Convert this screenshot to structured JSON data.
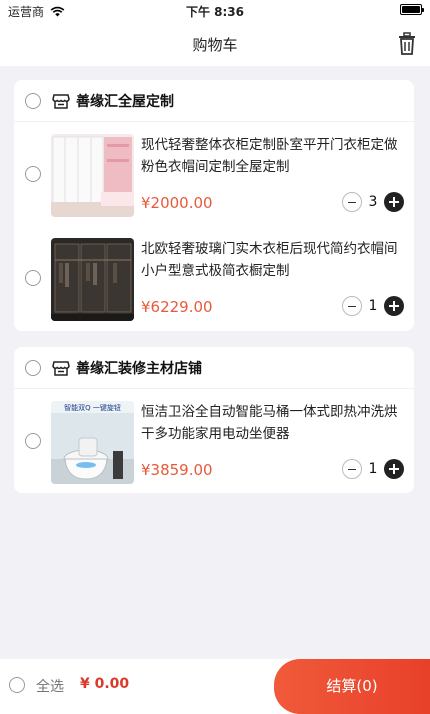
{
  "status_bar": {
    "carrier": "运营商",
    "time": "下午 8:36"
  },
  "header": {
    "title": "购物车"
  },
  "stores": [
    {
      "name": "善缘汇全屋定制",
      "items": [
        {
          "title": "现代轻奢整体衣柜定制卧室平开门衣柜定做粉色衣帽间定制全屋定制",
          "price": "¥2000.00",
          "quantity": "3"
        },
        {
          "title": "北欧轻奢玻璃门实木衣柜后现代简约衣帽间小户型意式极简衣橱定制",
          "price": "¥6229.00",
          "quantity": "1"
        }
      ]
    },
    {
      "name": "善缘汇装修主材店铺",
      "items": [
        {
          "title": "恒洁卫浴全自动智能马桶一体式即热冲洗烘干多功能家用电动坐便器",
          "price": "¥3859.00",
          "quantity": "1",
          "thumb_text": "智能双Q 一键旋钮"
        }
      ]
    }
  ],
  "footer": {
    "select_all_label": "全选",
    "total": "¥ 0.00",
    "checkout_label": "结算(0)"
  },
  "colors": {
    "price": "#e85a3c",
    "checkout": "#e8402a"
  }
}
